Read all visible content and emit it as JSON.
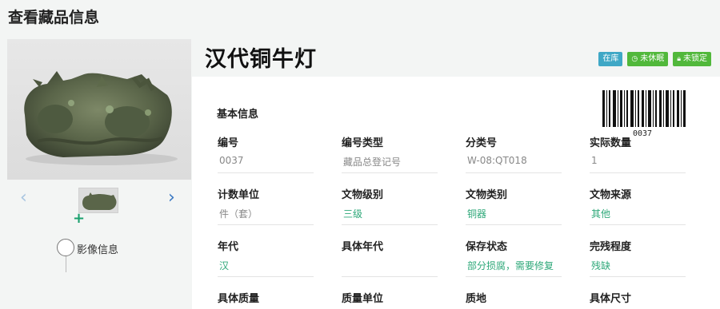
{
  "page": {
    "title": "查看藏品信息"
  },
  "item": {
    "name": "汉代铜牛灯",
    "badges": [
      "在库",
      "未休眠",
      "未锁定"
    ]
  },
  "left_panel": {
    "nav_prev": "‹",
    "nav_next": "›",
    "add": "+",
    "timeline_label": "影像信息"
  },
  "basic_info": {
    "title": "基本信息",
    "barcode_number": "0037",
    "fields": [
      {
        "label": "编号",
        "value": "0037"
      },
      {
        "label": "编号类型",
        "value": "藏品总登记号"
      },
      {
        "label": "分类号",
        "value": "W-08:QT018"
      },
      {
        "label": "实际数量",
        "value": "1"
      },
      {
        "label": "计数单位",
        "value": "件（套）"
      },
      {
        "label": "文物级别",
        "value": "三级"
      },
      {
        "label": "文物类别",
        "value": "铜器"
      },
      {
        "label": "文物来源",
        "value": "其他"
      },
      {
        "label": "年代",
        "value": "汉"
      },
      {
        "label": "具体年代",
        "value": ""
      },
      {
        "label": "保存状态",
        "value": "部分损腐，需要修复"
      },
      {
        "label": "完残程度",
        "value": "残缺"
      },
      {
        "label": "具体质量",
        "value": ""
      },
      {
        "label": "质量单位",
        "value": ""
      },
      {
        "label": "质地",
        "value": ""
      },
      {
        "label": "具体尺寸",
        "value": ""
      }
    ]
  }
}
